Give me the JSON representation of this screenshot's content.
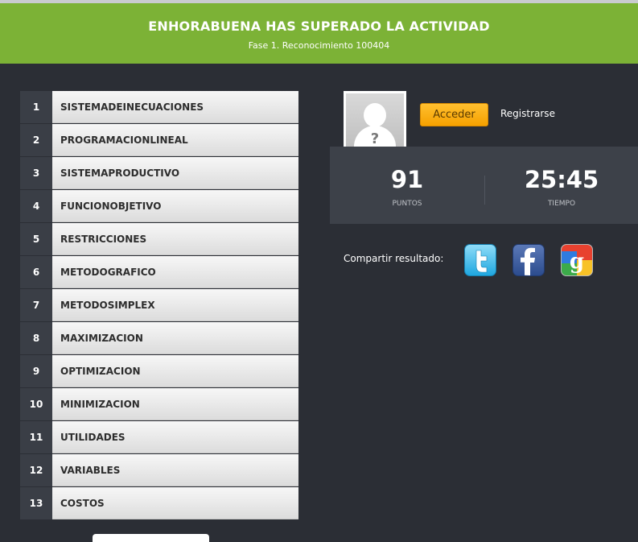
{
  "header": {
    "title": "ENHORABUENA HAS SUPERADO LA ACTIVIDAD",
    "subtitle": "Fase 1. Reconocimiento 100404"
  },
  "words": [
    {
      "num": "1",
      "word": "SISTEMADEINECUACIONES"
    },
    {
      "num": "2",
      "word": "PROGRAMACIONLINEAL"
    },
    {
      "num": "3",
      "word": "SISTEMAPRODUCTIVO"
    },
    {
      "num": "4",
      "word": "FUNCIONOBJETIVO"
    },
    {
      "num": "5",
      "word": "RESTRICCIONES"
    },
    {
      "num": "6",
      "word": "METODOGRAFICO"
    },
    {
      "num": "7",
      "word": "METODOSIMPLEX"
    },
    {
      "num": "8",
      "word": "MAXIMIZACION"
    },
    {
      "num": "9",
      "word": "OPTIMIZACION"
    },
    {
      "num": "10",
      "word": "MINIMIZACION"
    },
    {
      "num": "11",
      "word": "UTILIDADES"
    },
    {
      "num": "12",
      "word": "VARIABLES"
    },
    {
      "num": "13",
      "word": "COSTOS"
    }
  ],
  "auth": {
    "acceder_label": "Acceder",
    "registrarse_label": "Registrarse",
    "avatar_icon": "unknown-user-icon"
  },
  "stats": {
    "points_value": "91",
    "points_label": "PUNTOS",
    "time_value": "25:45",
    "time_label": "TIEMPO"
  },
  "share": {
    "label": "Compartir resultado:",
    "networks": [
      "twitter-icon",
      "facebook-icon",
      "google-icon"
    ]
  },
  "colors": {
    "header_green": "#7cb236",
    "background": "#2b2e35",
    "accent_orange": "#f5a100"
  }
}
